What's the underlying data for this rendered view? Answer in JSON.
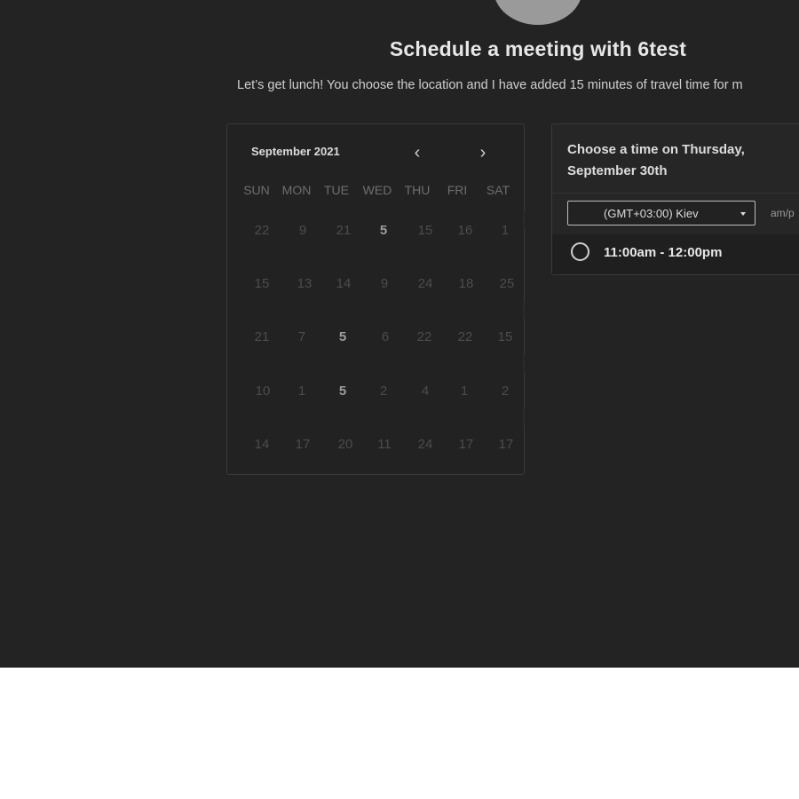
{
  "header": {
    "title": "Schedule a meeting with 6test",
    "subtitle": "Let’s get lunch! You choose the location and I have added 15 minutes of travel time for m"
  },
  "calendar": {
    "month_label": "September 2021",
    "prev_icon": "chevron-left-icon",
    "next_icon": "chevron-right-icon",
    "prev_glyph": "‹",
    "next_glyph": "›",
    "weekdays": [
      "SUN",
      "MON",
      "TUE",
      "WED",
      "THU",
      "FRI",
      "SAT"
    ],
    "weeks": [
      [
        "22",
        "9",
        "21",
        "5",
        "15",
        "16",
        "1"
      ],
      [
        "15",
        "13",
        "14",
        "9",
        "24",
        "18",
        "25"
      ],
      [
        "21",
        "7",
        "5",
        "6",
        "22",
        "22",
        "15"
      ],
      [
        "10",
        "1",
        "5",
        "2",
        "4",
        "1",
        "2"
      ],
      [
        "14",
        "17",
        "20",
        "11",
        "24",
        "17",
        "17"
      ]
    ]
  },
  "time_panel": {
    "heading_line1": "Choose a time on Thursday,",
    "heading_line2": "September 30th",
    "timezone": "(GMT+03:00) Kiev",
    "format_toggle": "am/p",
    "slots": [
      {
        "label": "11:00am - 12:00pm"
      }
    ]
  },
  "colors": {
    "background": "#232323",
    "below_fold": "#ffffff"
  }
}
